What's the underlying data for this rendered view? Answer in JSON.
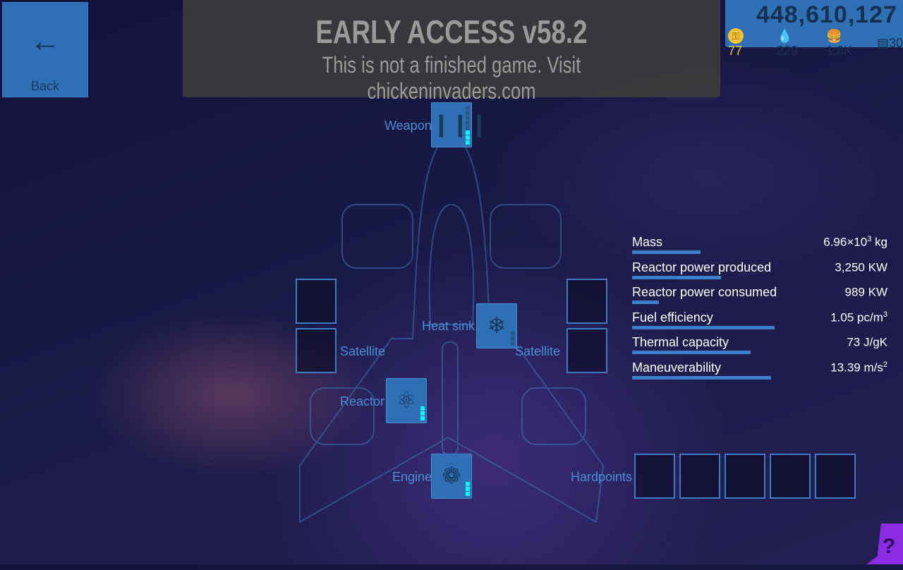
{
  "back": {
    "label": "Back",
    "icon": "arrow-left-icon"
  },
  "banner": {
    "title": "EARLY ACCESS v58.2",
    "subtitle": "This is not a finished game. Visit chickeninvaders.com"
  },
  "resources": {
    "score": "448,610,127",
    "keys": "77",
    "fuel": "229",
    "food": "1.8K",
    "levels": "30"
  },
  "slots": {
    "weapon": {
      "label": "Weapon",
      "level": 3,
      "max": 8
    },
    "heat_sink": {
      "label": "Heat sink",
      "level": 0,
      "max": 3
    },
    "reactor": {
      "label": "Reactor",
      "level": 3,
      "max": 3
    },
    "engine": {
      "label": "Engine",
      "level": 3,
      "max": 3
    },
    "satellite_left": {
      "label": "Satellite"
    },
    "satellite_right": {
      "label": "Satellite"
    },
    "hardpoints": {
      "label": "Hardpoints",
      "count": 5
    }
  },
  "stats": [
    {
      "name": "Mass",
      "value": "6.96×10",
      "sup": "3",
      "unit": " kg",
      "fill": 0.46
    },
    {
      "name": "Reactor power produced",
      "value": "3,250 KW",
      "sup": "",
      "unit": "",
      "fill": 0.6
    },
    {
      "name": "Reactor power consumed",
      "value": "989 KW",
      "sup": "",
      "unit": "",
      "fill": 0.18
    },
    {
      "name": "Fuel efficiency",
      "value": "1.05 pc/m",
      "sup": "3",
      "unit": "",
      "fill": 0.96
    },
    {
      "name": "Thermal capacity",
      "value": "73 J/gK",
      "sup": "",
      "unit": "",
      "fill": 0.8
    },
    {
      "name": "Maneuverability",
      "value": "13.39 m/s",
      "sup": "2",
      "unit": "",
      "fill": 0.94
    }
  ],
  "help": {
    "icon": "help-book-icon",
    "label": "?"
  },
  "colors": {
    "accent": "#2f6fb5",
    "level_on": "#16f0f8",
    "help": "#8a2be2"
  }
}
